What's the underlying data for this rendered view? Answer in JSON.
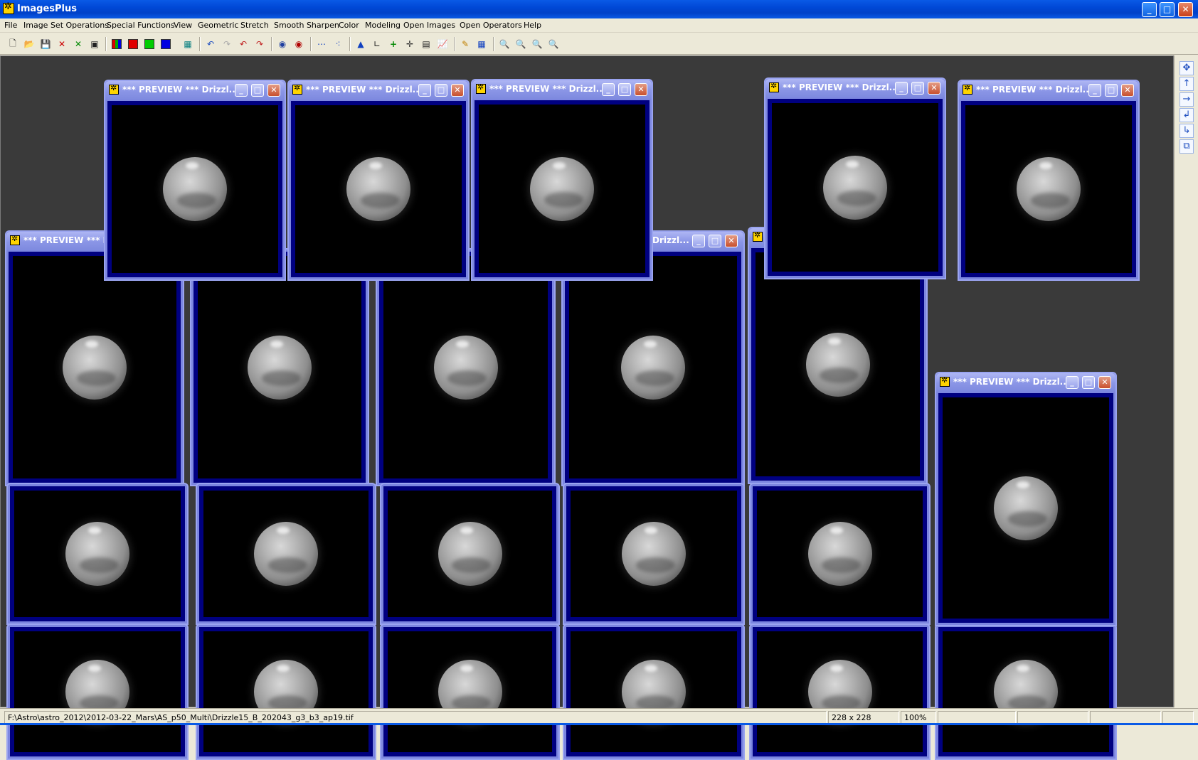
{
  "window": {
    "title": "ImagesPlus"
  },
  "menu": [
    "File",
    "Image Set Operations",
    "Special Functions",
    "View",
    "Geometric",
    "Stretch",
    "Smooth Sharpen",
    "Color",
    "Modeling",
    "Open Images",
    "Open Operators",
    "Help"
  ],
  "preview_window": {
    "title": "*** PREVIEW *** Drizzl...",
    "partial_title_left": "*** PREVIEW *** Dr",
    "partial_title_right": "Drizzl..."
  },
  "status": {
    "path": "F:\\Astro\\astro_2012\\2012-03-22_Mars\\AS_p50_Multi\\Drizzle15_B_202043_g3_b3_ap19.tif",
    "dimensions": "228 x 228",
    "zoom": "100%"
  },
  "colors": {
    "titlebar": "#0a5ae6",
    "child_titlebar": "#8a95e6",
    "image_frame": "#000080",
    "workspace": "#3a3a3a"
  },
  "icons": {
    "toolbar": [
      "new-icon",
      "open-icon",
      "save-icon",
      "delete-icon",
      "check-icon",
      "copy-icon",
      "rgb-icon",
      "red-channel-icon",
      "green-channel-icon",
      "blue-channel-icon",
      "grid-icon",
      "undo-icon",
      "redo-icon",
      "undo-all-icon",
      "redo-all-icon",
      "circle-mask-icon",
      "red-circle-icon",
      "dots-icon",
      "nodes-icon",
      "triangle-icon",
      "measure-icon",
      "cross-icon",
      "crosshair-icon",
      "histogram-icon",
      "chart-icon",
      "pencil-icon",
      "table-icon",
      "zoom-in-icon",
      "zoom-out-icon",
      "zoom-fit-icon",
      "zoom-actual-icon"
    ],
    "sidebar": [
      "move-icon",
      "arrow-up-icon",
      "arrow-right-icon",
      "cascade-icon",
      "tile-icon",
      "windows-icon"
    ]
  }
}
